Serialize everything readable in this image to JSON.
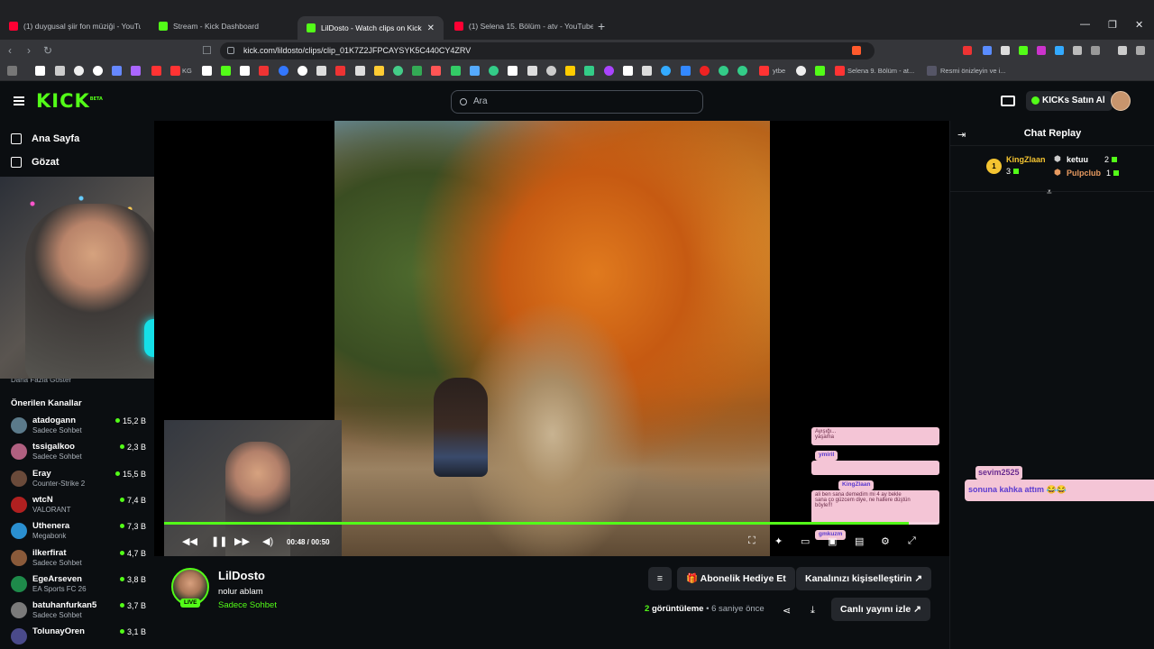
{
  "browser": {
    "tabs": [
      {
        "title": "(1) duygusal şiir fon müziği - YouTub",
        "icon": "youtube-icon"
      },
      {
        "title": "Stream - Kick Dashboard",
        "icon": "kick-icon"
      },
      {
        "title": "LilDosto - Watch clips on Kick",
        "icon": "kick-icon",
        "active": true
      },
      {
        "title": "(1) Selena 15. Bölüm - atv - YouTube",
        "icon": "youtube-icon"
      }
    ],
    "url": "kick.com/lildosto/clips/clip_01K7Z2JFPCAYSYK5C440CY4ZRV",
    "bookmarks": {
      "kg": "KG",
      "ytbe": "ytbe",
      "selena": "Selena 9. Bölüm - at...",
      "resmi": "Resmi önizleyin ve i..."
    }
  },
  "header": {
    "logo": "KICK",
    "logo_beta": "BETA",
    "search_placeholder": "Ara",
    "buy_kicks": "KICKs Satın Al"
  },
  "sidebar": {
    "nav": [
      {
        "label": "Ana Sayfa",
        "icon": "home-icon"
      },
      {
        "label": "Gözat",
        "icon": "browse-icon"
      }
    ],
    "show_more": "Daha Fazla Göster",
    "recommended_title": "Önerilen Kanallar",
    "channels": [
      {
        "name": "atadogann",
        "category": "Sadece Sohbet",
        "viewers": "15,2 B",
        "color": "#5b7a8a"
      },
      {
        "name": "tssigalkoo",
        "category": "Sadece Sohbet",
        "viewers": "2,3 B",
        "color": "#b06080"
      },
      {
        "name": "Eray",
        "category": "Counter-Strike 2",
        "viewers": "15,5 B",
        "color": "#6a4a3a"
      },
      {
        "name": "wtcN",
        "category": "VALORANT",
        "viewers": "7,4 B",
        "color": "#b02020"
      },
      {
        "name": "Uthenera",
        "category": "Megabonk",
        "viewers": "7,3 B",
        "color": "#2a8fd0"
      },
      {
        "name": "ilkerfirat",
        "category": "Sadece Sohbet",
        "viewers": "4,7 B",
        "color": "#8a5a3a"
      },
      {
        "name": "EgeArseven",
        "category": "EA Sports FC 26",
        "viewers": "3,8 B",
        "color": "#1e8a4a"
      },
      {
        "name": "batuhanfurkan5",
        "category": "Sadece Sohbet",
        "viewers": "3,7 B",
        "color": "#7a7a7a"
      },
      {
        "name": "TolunayOren",
        "category": "",
        "viewers": "3,1 B",
        "color": "#4a4a8a"
      }
    ]
  },
  "player": {
    "time": "00:48 / 00:50",
    "progress": 0.96,
    "overlay_chat": {
      "names": [
        "ymiril",
        "KingZlaan",
        "gmkuzm"
      ],
      "lines": [
        "Ayışığı...",
        "yaşama",
        "ali ben sana demedim mi 4 ay bekle",
        "sana ço güzcem diye, ne hallere düştün",
        "böyle!!!"
      ]
    }
  },
  "channel": {
    "name": "LilDosto",
    "live_badge": "LIVE",
    "subtitle": "nolur ablam",
    "category": "Sadece Sohbet",
    "gift_sub": "Abonelik Hediye Et",
    "customize": "Kanalınızı kişiselleştirin",
    "views_count": "2",
    "views_label": "görüntüleme",
    "time_ago": "6 saniye önce",
    "watch_live": "Canlı yayını izle"
  },
  "chat": {
    "title": "Chat Replay",
    "leaderboard": [
      {
        "rank": "1",
        "name": "KingZlaan",
        "count": "3"
      },
      {
        "rank": "",
        "name": "ketuu",
        "count": "2"
      },
      {
        "rank": "",
        "name": "Pulpclub",
        "count": "1"
      }
    ],
    "popup_user": "sevim2525",
    "popup_message": "sonuna kahka attım 😂😂"
  },
  "colors": {
    "kick_green": "#53fc18",
    "background": "#0b0e11",
    "pink_chat": "#f4c5d6"
  }
}
